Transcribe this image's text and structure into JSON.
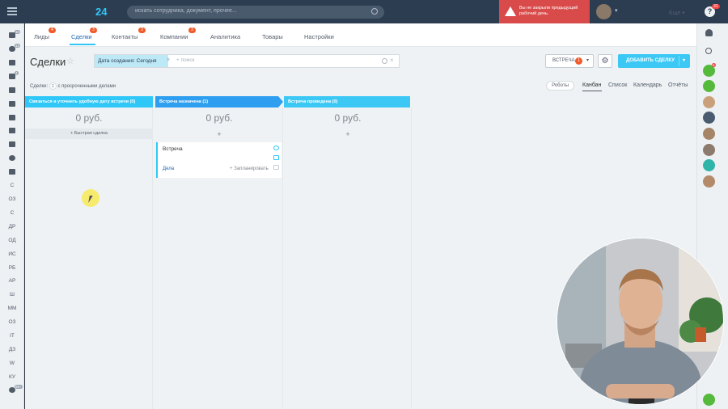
{
  "topbar": {
    "logo": "24",
    "search_placeholder": "искать сотрудника, документ, прочее...",
    "notice": "Вы не закрыли предыдущий рабочий день.",
    "help_label": "?",
    "help_badge": "31"
  },
  "left_rail": {
    "badges": [
      "10",
      "12",
      "4",
      "99+"
    ],
    "labels": [
      "С",
      "ОЗ",
      "С",
      "ДР",
      "ОД",
      "ИС",
      "РБ",
      "АР",
      "Ш",
      "ММ",
      "ОЗ",
      "IT",
      "ДЗ",
      "W",
      "КУ"
    ]
  },
  "tabs": [
    {
      "label": "Лиды",
      "badge": "4"
    },
    {
      "label": "Сделки",
      "badge": "3"
    },
    {
      "label": "Контакты",
      "badge": "3"
    },
    {
      "label": "Компании",
      "badge": "3"
    },
    {
      "label": "Аналитика",
      "badge": ""
    },
    {
      "label": "Товары",
      "badge": ""
    },
    {
      "label": "Настройки",
      "badge": ""
    }
  ],
  "more_label": "Еще ▾",
  "page_title": "Сделки",
  "filter": {
    "chip": "Дата создания: Сегодня",
    "chip_close": "×",
    "search_placeholder": "+ поиск",
    "clear": "×"
  },
  "toolbar": {
    "meeting_label": "ВСТРЕЧА",
    "meeting_badge": "1",
    "add_label": "ДОБАВИТЬ СДЕЛКУ"
  },
  "subbar": {
    "prefix": "Сделки:",
    "count": "1",
    "suffix": "с просроченными делами",
    "robots": "Роботы"
  },
  "views": [
    "Канбан",
    "Список",
    "Календарь",
    "Отчёты"
  ],
  "columns": [
    {
      "title": "Связаться и уточнить удобную дату встречи",
      "count": "(0)",
      "sum": "0 руб.",
      "color": "#2fc7f7",
      "quick": "+ Быстрая сделка"
    },
    {
      "title": "Встреча назначена",
      "count": "(1)",
      "sum": "0 руб.",
      "color": "#2d9ef0"
    },
    {
      "title": "Встреча проведена",
      "count": "(0)",
      "sum": "0 руб.",
      "color": "#3bc8f5"
    }
  ],
  "column_add": "+",
  "card": {
    "title": "Встреча",
    "deals_link": "Дела",
    "plan_link": "+ Запланировать"
  },
  "right_rail": {
    "badge": "6"
  }
}
